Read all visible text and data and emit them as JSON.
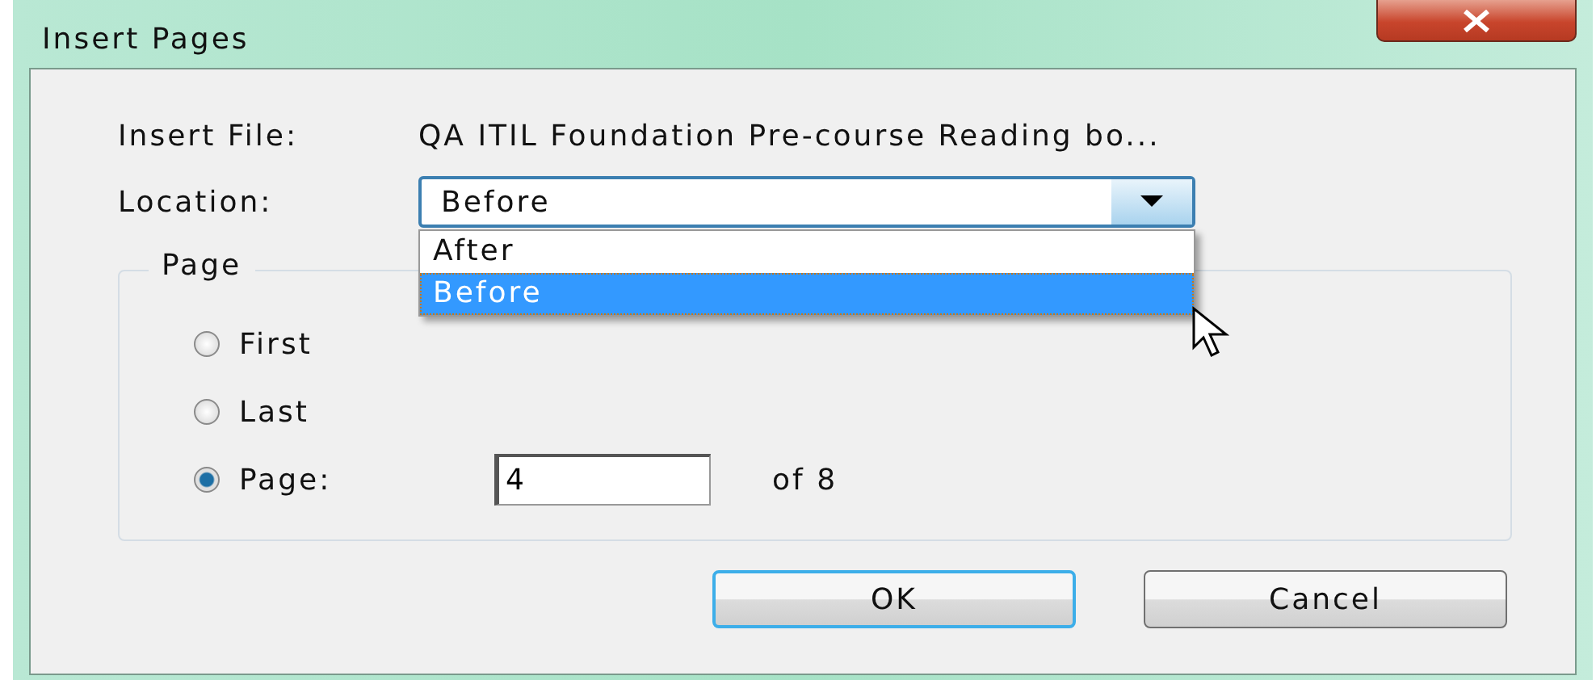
{
  "window": {
    "title": "Insert Pages"
  },
  "insert_file": {
    "label": "Insert File:",
    "value": "QA ITIL Foundation Pre-course Reading bo..."
  },
  "location": {
    "label": "Location:",
    "value": "Before",
    "expanded": true,
    "options": [
      {
        "label": "After",
        "selected": false
      },
      {
        "label": "Before",
        "selected": true
      }
    ]
  },
  "page_group": {
    "title": "Page",
    "options": [
      {
        "label": "First",
        "selected": false
      },
      {
        "label": "Last",
        "selected": false
      },
      {
        "label": "Page:",
        "selected": true,
        "field_value": "4",
        "suffix": "of 8"
      }
    ]
  },
  "buttons": [
    {
      "label": "OK",
      "default": true
    },
    {
      "label": "Cancel",
      "default": false
    }
  ]
}
